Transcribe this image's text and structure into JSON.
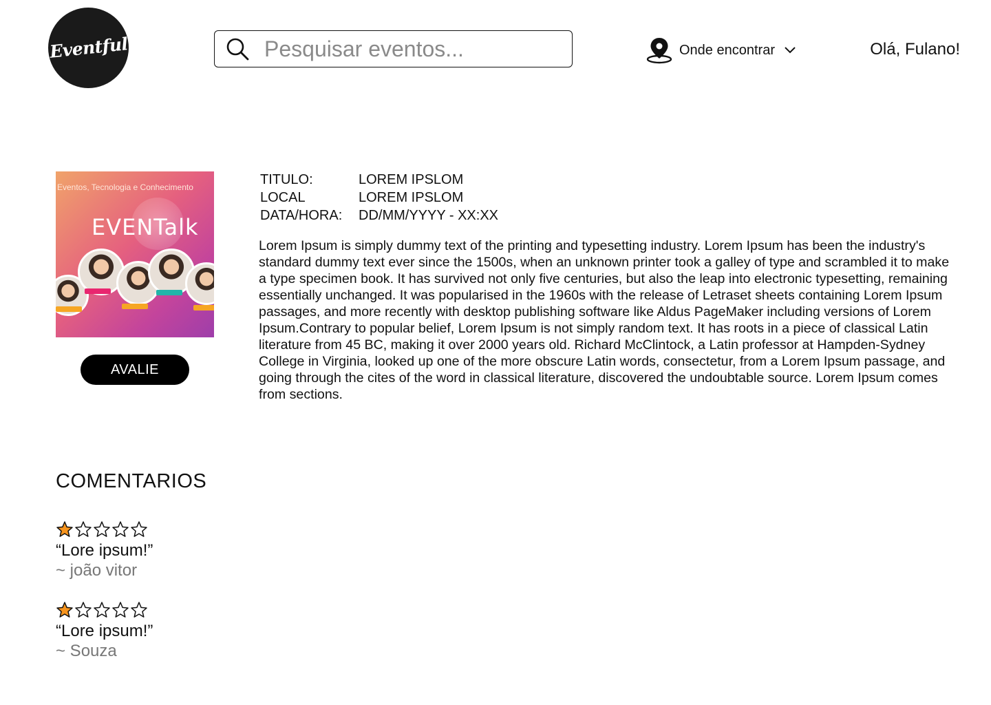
{
  "header": {
    "logo_text": "Eventful",
    "search_placeholder": "Pesquisar eventos...",
    "location_label": "Onde encontrar",
    "greeting": "Olá, Fulano!"
  },
  "event": {
    "image": {
      "tagline": "Eventos, Tecnologia e Conhecimento",
      "brand": "EVENTalk"
    },
    "rate_button": "AVALIE",
    "fields": [
      {
        "label": "TITULO:",
        "value": "LOREM IPSLOM"
      },
      {
        "label": "LOCAL",
        "value": "LOREM IPSLOM"
      },
      {
        "label": "DATA/HORA:",
        "value": "DD/MM/YYYY - XX:XX"
      }
    ],
    "description": "Lorem Ipsum is simply dummy text of the printing and typesetting industry. Lorem Ipsum has been the industry's standard dummy text ever since the 1500s, when an unknown printer took a galley of type and scrambled it to make a type specimen book. It has survived not only five centuries, but also the leap into electronic typesetting, remaining essentially unchanged. It was popularised in the 1960s with the release of Letraset sheets containing Lorem Ipsum passages, and more recently with desktop publishing software like Aldus PageMaker including versions of Lorem Ipsum.Contrary to popular belief, Lorem Ipsum is not simply random text. It has roots in a piece of classical Latin literature from 45 BC, making it over 2000 years old. Richard McClintock, a Latin professor at Hampden-Sydney College in Virginia, looked up one of the more obscure Latin words, consectetur, from a Lorem Ipsum passage, and going through the cites of the word in classical literature, discovered the undoubtable source. Lorem Ipsum comes from sections."
  },
  "comments": {
    "title": "COMENTARIOS",
    "items": [
      {
        "rating": 1,
        "max": 5,
        "text": "“Lore ipsum!”",
        "author": "~ joão vitor"
      },
      {
        "rating": 1,
        "max": 5,
        "text": "“Lore ipsum!”",
        "author": "~ Souza"
      }
    ]
  },
  "colors": {
    "star_filled": "#f7941d",
    "button_bg": "#000000",
    "author_text": "#777777"
  }
}
